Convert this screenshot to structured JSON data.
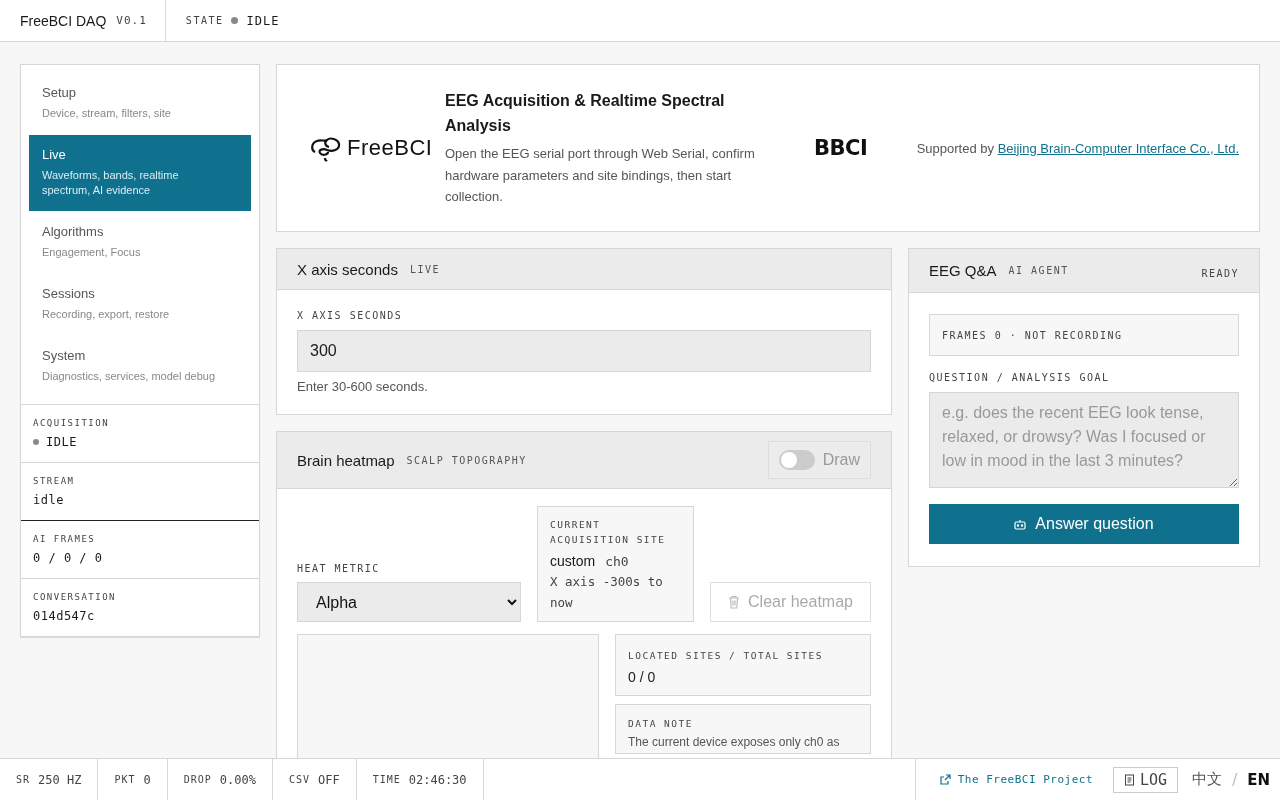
{
  "app": {
    "name": "FreeBCI DAQ",
    "version": "V0.1",
    "state_label": "STATE",
    "state": "IDLE"
  },
  "sidebar": {
    "items": [
      {
        "title": "Setup",
        "subtitle": "Device, stream, filters, site",
        "selected": false
      },
      {
        "title": "Live",
        "subtitle": "Waveforms, bands, realtime spectrum, AI evidence",
        "selected": true
      },
      {
        "title": "Algorithms",
        "subtitle": "Engagement, Focus",
        "selected": false
      },
      {
        "title": "Sessions",
        "subtitle": "Recording, export, restore",
        "selected": false
      },
      {
        "title": "System",
        "subtitle": "Diagnostics, services, model debug",
        "selected": false
      }
    ],
    "stats": [
      {
        "label": "ACQUISITION",
        "value": "IDLE",
        "kind": "status"
      },
      {
        "label": "STREAM",
        "value": "idle",
        "kind": "plain"
      },
      {
        "label": "AI FRAMES",
        "value": "0 / 0 / 0",
        "kind": "plain"
      },
      {
        "label": "CONVERSATION",
        "value": "014d547c",
        "kind": "plain"
      }
    ]
  },
  "hero": {
    "logo_text": "FreeBCI",
    "title": "EEG Acquisition & Realtime Spectral Analysis",
    "description": "Open the EEG serial port through Web Serial, confirm hardware parameters and site bindings, then start collection.",
    "partner_logo": "BBCI",
    "supported_by": "Supported by",
    "partner_link": "Beijing Brain-Computer Interface Co., Ltd."
  },
  "axis_panel": {
    "title": "X axis seconds",
    "tag": "LIVE",
    "field_label": "X AXIS SECONDS",
    "value": "300",
    "hint": "Enter 30-600 seconds."
  },
  "heatmap_panel": {
    "title": "Brain heatmap",
    "tag": "SCALP TOPOGRAPHY",
    "draw_toggle": {
      "label": "Draw",
      "on": false,
      "disabled": true
    },
    "metric_label": "HEAT METRIC",
    "metric": "Alpha",
    "site": {
      "label": "CURRENT ACQUISITION SITE",
      "name": "custom",
      "channel": "ch0",
      "range": "X axis -300s to now"
    },
    "clear_button": {
      "label": "Clear heatmap",
      "disabled": true
    },
    "located": {
      "label": "LOCATED SITES / TOTAL SITES",
      "value": "0 / 0"
    },
    "note": {
      "label": "DATA NOTE",
      "text": "The current device exposes only ch0 as"
    }
  },
  "qa_panel": {
    "title": "EEG Q&A",
    "tag": "AI AGENT",
    "status": "READY",
    "frames": "FRAMES 0 · NOT RECORDING",
    "question_label": "QUESTION / ANALYSIS GOAL",
    "placeholder": "e.g. does the recent EEG look tense, relaxed, or drowsy? Was I focused or low in mood in the last 3 minutes?",
    "button": "Answer question"
  },
  "status_bar": {
    "items": [
      {
        "label": "SR",
        "value": "250 HZ"
      },
      {
        "label": "PKT",
        "value": "0"
      },
      {
        "label": "DROP",
        "value": "0.00%"
      },
      {
        "label": "CSV",
        "value": "OFF"
      },
      {
        "label": "TIME",
        "value": "02:46:30"
      }
    ],
    "project_link": "The FreeBCI Project",
    "log_button": "LOG",
    "separator": "/",
    "languages": [
      {
        "label": "中文",
        "selected": false
      },
      {
        "label": "EN",
        "selected": true
      }
    ]
  }
}
